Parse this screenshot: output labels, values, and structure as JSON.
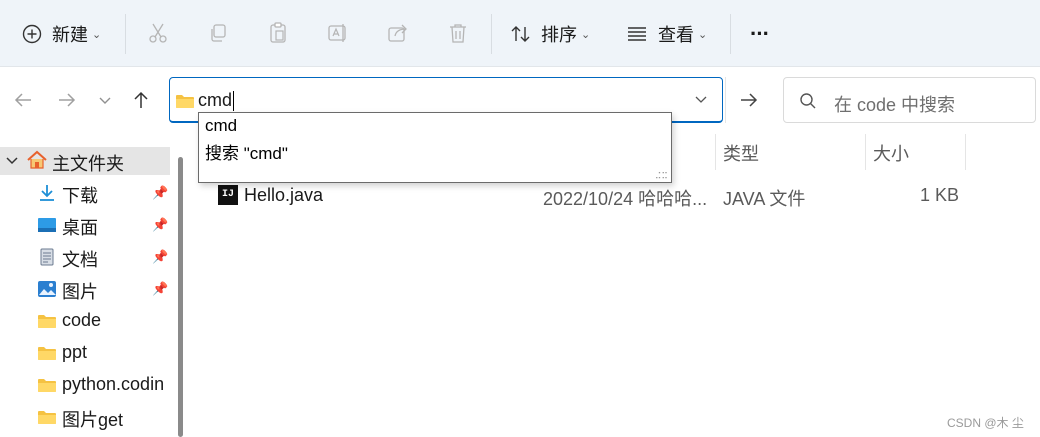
{
  "toolbar": {
    "new_label": "新建",
    "sort_label": "排序",
    "view_label": "查看",
    "more_label": "···"
  },
  "address": {
    "value": "cmd"
  },
  "search": {
    "placeholder": "在 code 中搜索"
  },
  "autocomplete": {
    "items": [
      "cmd",
      "搜索 \"cmd\""
    ]
  },
  "sidebar": {
    "items": [
      {
        "label": "主文件夹",
        "icon": "home-icon"
      },
      {
        "label": "下载",
        "icon": "download-icon",
        "pinned": true
      },
      {
        "label": "桌面",
        "icon": "desktop-icon",
        "pinned": true
      },
      {
        "label": "文档",
        "icon": "document-icon",
        "pinned": true
      },
      {
        "label": "图片",
        "icon": "picture-icon",
        "pinned": true
      },
      {
        "label": "code",
        "icon": "folder-icon"
      },
      {
        "label": "ppt",
        "icon": "folder-icon"
      },
      {
        "label": "python.codin",
        "icon": "folder-icon"
      },
      {
        "label": "图片get",
        "icon": "folder-icon"
      }
    ]
  },
  "columns": {
    "type": "类型",
    "size": "大小"
  },
  "files": [
    {
      "name": "Hello.java",
      "modified": "2022/10/24 哈哈哈...",
      "type": "JAVA 文件",
      "size": "1 KB",
      "icon_text": "IJ"
    }
  ],
  "watermark": "CSDN @木 尘",
  "colors": {
    "accent": "#0067c0",
    "toolbar_bg": "#eff4f9",
    "folder": "#f5c242"
  }
}
